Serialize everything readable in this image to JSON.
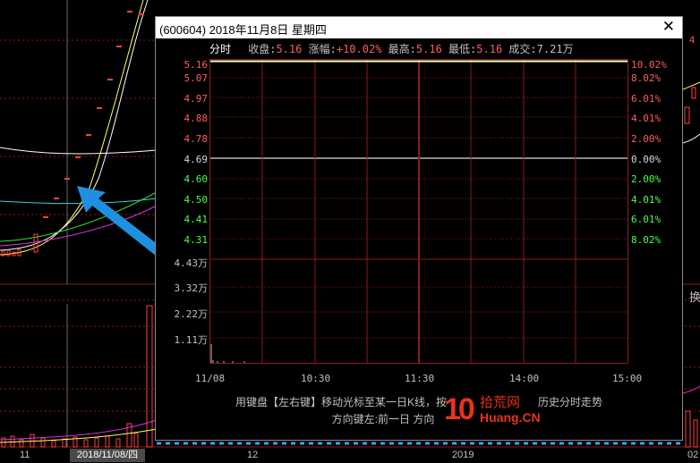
{
  "background": {
    "x_axis_labels": [
      "11",
      "12",
      "2019",
      "02"
    ],
    "cursor_date": "2018/11/08/四",
    "right_partial_label": "换",
    "right_partial_num": "4"
  },
  "dialog": {
    "title": "(600604) 2018年11月8日 星期四",
    "close_label": "✕",
    "info": {
      "tab_label": "分时",
      "close_price_label": "收盘:",
      "close_price": "5.16",
      "change_label": "涨幅:",
      "change": "+10.02%",
      "high_label": "最高:",
      "high": "5.16",
      "low_label": "最低:",
      "low": "5.16",
      "volume_label": "成交:",
      "volume": "7.21万"
    },
    "price_labels": [
      {
        "price": "5.16",
        "pct": "10.02%",
        "color": "#ff5c5c"
      },
      {
        "price": "5.07",
        "pct": "8.02%",
        "color": "#ff5c5c"
      },
      {
        "price": "4.97",
        "pct": "6.01%",
        "color": "#ff5c5c"
      },
      {
        "price": "4.88",
        "pct": "4.01%",
        "color": "#ff5c5c"
      },
      {
        "price": "4.78",
        "pct": "2.00%",
        "color": "#ff5c5c"
      },
      {
        "price": "4.69",
        "pct": "0.00%",
        "color": "#d8d8d8"
      },
      {
        "price": "4.60",
        "pct": "2.00%",
        "color": "#4cff4c"
      },
      {
        "price": "4.50",
        "pct": "4.01%",
        "color": "#4cff4c"
      },
      {
        "price": "4.41",
        "pct": "6.01%",
        "color": "#4cff4c"
      },
      {
        "price": "4.31",
        "pct": "8.02%",
        "color": "#4cff4c"
      }
    ],
    "volume_labels": [
      "4.43万",
      "3.32万",
      "2.22万",
      "1.11万"
    ],
    "time_labels": [
      "11/08",
      "10:30",
      "11:30",
      "14:00",
      "15:00"
    ],
    "hint_line1": "用键盘【左右键】移动光标至某一日K线，按",
    "hint_line1_tail": "历史分时走势",
    "hint_line2": "方向键左:前一日 方向",
    "colors": {
      "price_line": "#ffff66",
      "up": "#ff5c5c",
      "down": "#4cff4c",
      "grid": "#8b1a1a"
    }
  },
  "watermark": {
    "logo_num": "10",
    "logo_cn": "拾荒网",
    "logo_en": "Huang.CN"
  }
}
